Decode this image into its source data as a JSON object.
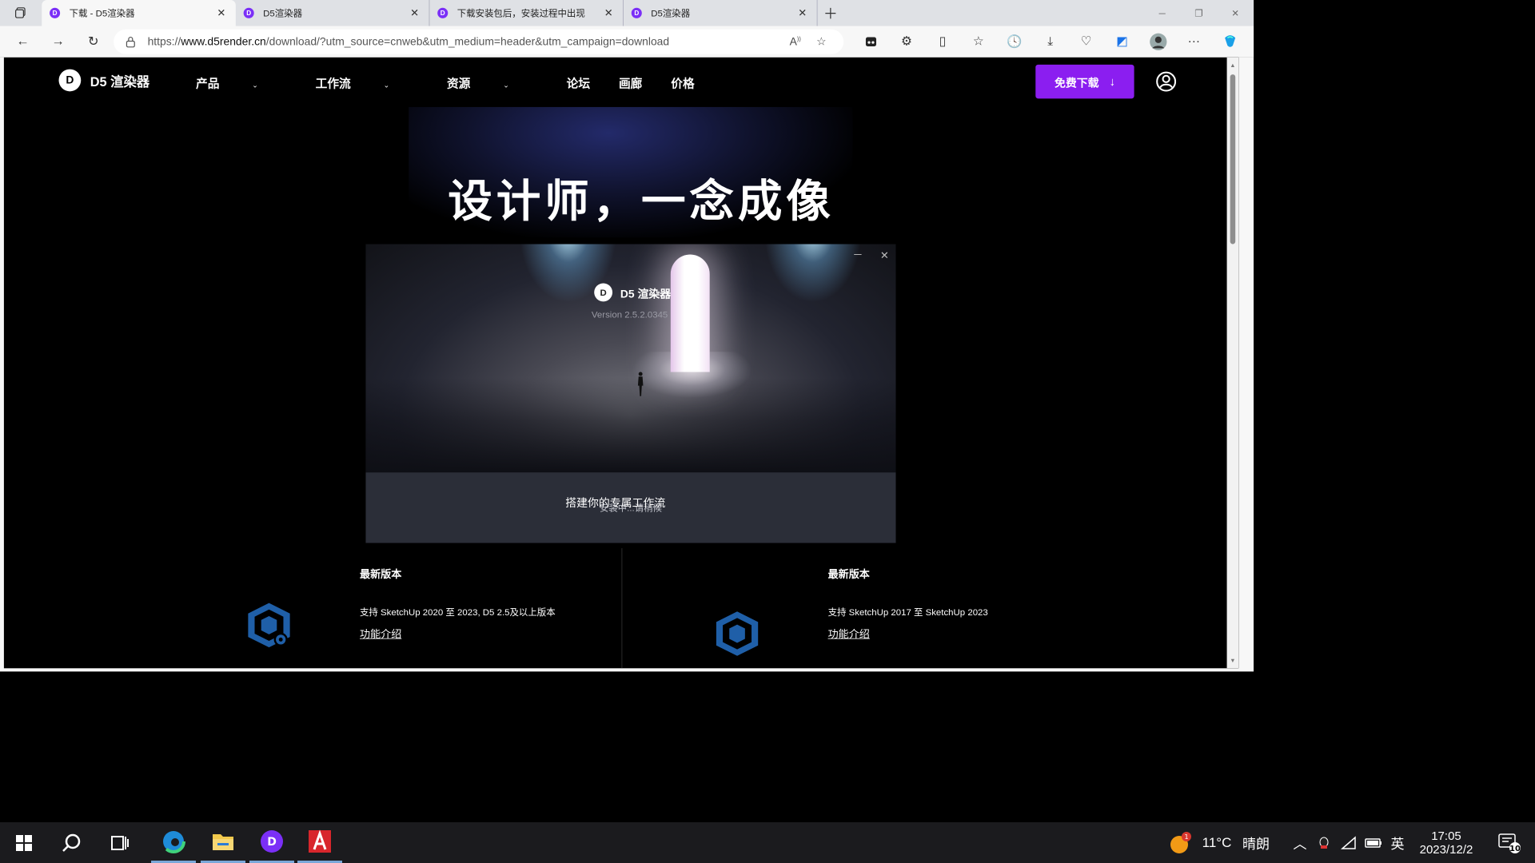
{
  "browser": {
    "tabs": [
      {
        "title": "下载 - D5渲染器",
        "active": true
      },
      {
        "title": "D5渲染器",
        "active": false
      },
      {
        "title": "下载安装包后，安装过程中出现",
        "active": false
      },
      {
        "title": "D5渲染器",
        "active": false
      }
    ],
    "url": {
      "prefix": "https://",
      "domain": "www.d5render.cn",
      "path": "/download/?utm_source=cnweb&utm_medium=header&utm_campaign=download"
    }
  },
  "site": {
    "logo": "D5 渲染器",
    "logo_mark": "D",
    "nav": [
      {
        "label": "产品",
        "caret": true
      },
      {
        "label": "工作流",
        "caret": true
      },
      {
        "label": "资源",
        "caret": true
      },
      {
        "label": "论坛",
        "caret": false
      },
      {
        "label": "画廊",
        "caret": false
      },
      {
        "label": "价格",
        "caret": false
      }
    ],
    "download_btn": "免费下载",
    "hero_title": "设计师，一念成像",
    "subtitle": "搭建你的专属工作流",
    "plugins": [
      {
        "latest_label": "最新版本",
        "support": "支持 SketchUp 2020 至 2023, D5 2.5及以上版本",
        "link": "功能介绍"
      },
      {
        "latest_label": "最新版本",
        "support": "支持 SketchUp 2017 至 SketchUp 2023",
        "link": "功能介绍"
      }
    ]
  },
  "installer": {
    "logo_text": "D5 渲染器",
    "version": "Version 2.5.2.0345",
    "status": "安装中...请稍候"
  },
  "taskbar": {
    "weather": {
      "temp": "11°C",
      "condition": "晴朗",
      "badge": "1"
    },
    "ime": "英",
    "time": "17:05",
    "date": "2023/12/2",
    "notif_count": "10"
  },
  "colors": {
    "accent": "#8b1ef0",
    "favicon": "#7b2ff7",
    "sketchup_blue": "#1f5fa8"
  },
  "icons": [
    "workspaces-icon",
    "close-icon",
    "new-tab-icon",
    "back-icon",
    "forward-icon",
    "refresh-icon",
    "lock-icon",
    "read-aloud-icon",
    "favorite-star-icon",
    "extension-icon",
    "puzzle-icon",
    "split-screen-icon",
    "favorites-icon",
    "history-icon",
    "download-icon",
    "performance-icon",
    "edge-bar-icon",
    "profile-avatar-icon",
    "more-icon",
    "copilot-icon",
    "user-icon",
    "download-arrow-icon",
    "sketchup-icon",
    "windows-icon",
    "search-icon",
    "task-view-icon",
    "edge-icon",
    "file-explorer-icon",
    "d5-app-icon",
    "autocad-icon",
    "weather-icon",
    "tray-up-icon",
    "security-icon",
    "network-icon",
    "battery-icon",
    "notification-icon"
  ]
}
